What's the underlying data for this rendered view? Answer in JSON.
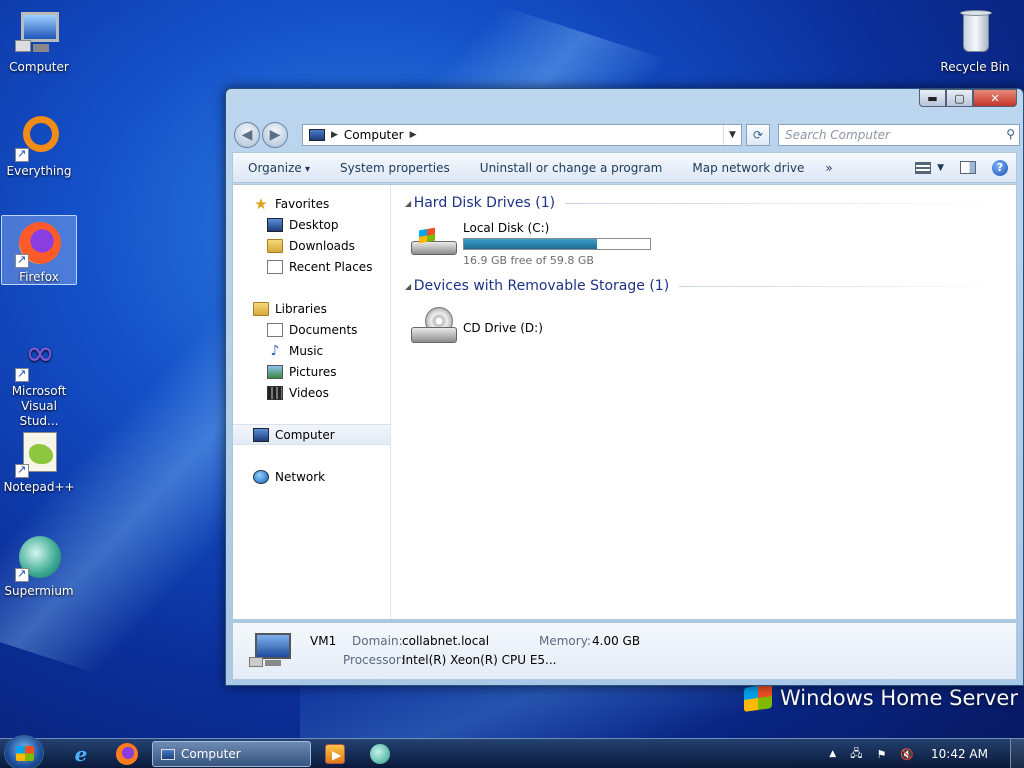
{
  "desktop": {
    "icons": [
      {
        "label": "Computer",
        "icon": "computer-icon"
      },
      {
        "label": "Everything",
        "icon": "everything-icon"
      },
      {
        "label": "Firefox",
        "icon": "firefox-icon"
      },
      {
        "label_line1": "Microsoft",
        "label_line2": "Visual Stud...",
        "icon": "visual-studio-icon"
      },
      {
        "label": "Notepad++",
        "icon": "notepadpp-icon"
      },
      {
        "label": "Supermium",
        "icon": "supermium-icon"
      },
      {
        "label": "Recycle Bin",
        "icon": "recycle-bin-icon"
      }
    ],
    "brand": "Windows Home Server"
  },
  "window": {
    "controls": {
      "minimize": "▬",
      "maximize": "▢",
      "close": "✕"
    },
    "nav": {
      "back": "◀",
      "forward": "▶"
    },
    "address": {
      "crumb_sep": "▶",
      "location": "Computer",
      "after_sep": "▶",
      "dropdown": "▼"
    },
    "refresh": "⟳",
    "search": {
      "placeholder": "Search Computer",
      "icon": "⚲"
    },
    "toolbar": {
      "organize": "Organize",
      "system_properties": "System properties",
      "uninstall": "Uninstall or change a program",
      "map_network": "Map network drive",
      "more": "»",
      "view_dropdown": "▼",
      "help": "?"
    },
    "navpane": {
      "favorites": "Favorites",
      "desktop": "Desktop",
      "downloads": "Downloads",
      "recent_places": "Recent Places",
      "libraries": "Libraries",
      "documents": "Documents",
      "music": "Music",
      "pictures": "Pictures",
      "videos": "Videos",
      "computer": "Computer",
      "network": "Network"
    },
    "groups": {
      "hdd_title": "Hard Disk Drives (1)",
      "removable_title": "Devices with Removable Storage (1)"
    },
    "drives": {
      "c": {
        "name": "Local Disk (C:)",
        "free_text": "16.9 GB free of 59.8 GB",
        "used_fraction": 0.717
      },
      "d": {
        "name": "CD Drive (D:)"
      }
    },
    "details": {
      "name": "VM1",
      "domain_label": "Domain:",
      "domain": "collabnet.local",
      "memory_label": "Memory:",
      "memory": "4.00 GB",
      "processor_label": "Processor:",
      "processor": "Intel(R) Xeon(R) CPU E5..."
    }
  },
  "taskbar": {
    "active_window": "Computer",
    "tray": {
      "arrow": "▲",
      "clock": "10:42 AM"
    }
  }
}
